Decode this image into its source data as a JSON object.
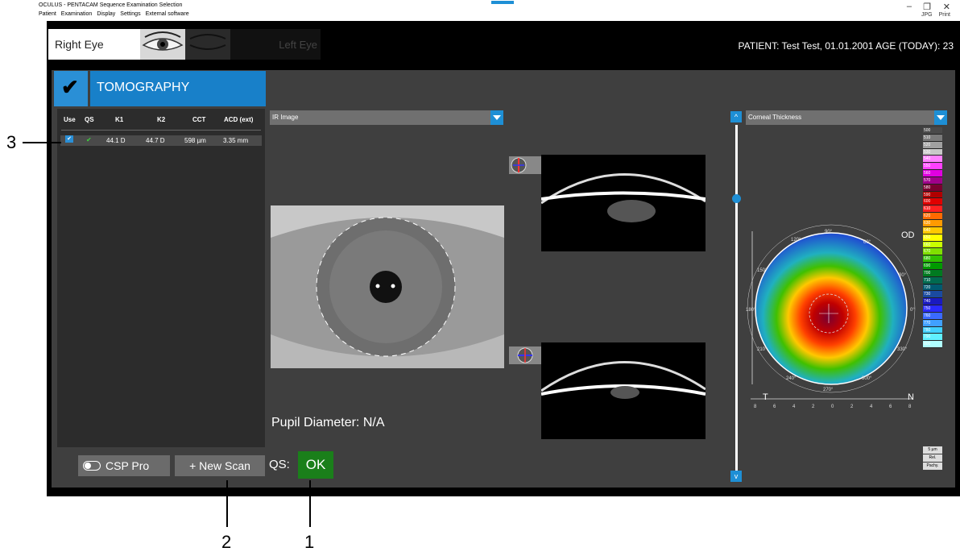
{
  "window": {
    "title": "OCULUS - PENTACAM  Sequence Examination Selection",
    "menu": [
      "Patient",
      "Examination",
      "Display",
      "Settings",
      "External software"
    ],
    "right_links": [
      "JPG",
      "Print"
    ]
  },
  "eye_selector": {
    "right": "Right Eye",
    "left": "Left Eye"
  },
  "patient_info": "PATIENT: Test Test, 01.01.2001   AGE (TODAY): 23",
  "tomography": {
    "check": "✔",
    "label": "TOMOGRAPHY"
  },
  "exam_table": {
    "headers": [
      "Use",
      "QS",
      "K1",
      "K2",
      "CCT",
      "ACD (ext)"
    ],
    "rows": [
      {
        "use": "✔",
        "qs": "✔",
        "k1": "44.1 D",
        "k2": "44.7 D",
        "cct": "598 µm",
        "acd": "3.35 mm"
      }
    ]
  },
  "buttons": {
    "csp_pro": "CSP Pro",
    "new_scan": "+ New Scan"
  },
  "qs": {
    "label": "QS:",
    "status": "OK",
    "status_color": "#1a7f1a"
  },
  "image_panel": {
    "dropdown": "IR Image",
    "pupil": "Pupil Diameter: N/A"
  },
  "map_panel": {
    "dropdown": "Corneal Thickness",
    "od": "OD",
    "t": "T",
    "n": "N",
    "axis_ticks": [
      "8",
      "6",
      "4",
      "2",
      "0",
      "2",
      "4",
      "6",
      "8"
    ],
    "angle_labels": [
      "90°",
      "60°",
      "30°",
      "0°",
      "330°",
      "300°",
      "270°",
      "240°",
      "210°",
      "180°",
      "150°",
      "120°"
    ]
  },
  "slider": {
    "up": "^",
    "down": "v"
  },
  "color_scale": {
    "values": [
      "500",
      "510",
      "520",
      "530",
      "540",
      "550",
      "560",
      "570",
      "580",
      "590",
      "600",
      "610",
      "620",
      "630",
      "640",
      "650",
      "660",
      "670",
      "680",
      "690",
      "700",
      "710",
      "720",
      "730",
      "740",
      "750",
      "760",
      "770",
      "780",
      "790",
      "800"
    ],
    "colors": [
      "#4a4a4a",
      "#7a7a7a",
      "#a0a0a0",
      "#c8c8c8",
      "#ff80ff",
      "#ff40ff",
      "#e000e0",
      "#a0008a",
      "#7a0030",
      "#b00000",
      "#e00000",
      "#ff2020",
      "#ff6a00",
      "#ff9a00",
      "#ffc800",
      "#ffff00",
      "#c8ff00",
      "#80e000",
      "#30c000",
      "#009a00",
      "#007a20",
      "#006a50",
      "#005a70",
      "#1a4aa0",
      "#1a1ac0",
      "#2a2aff",
      "#3a6aff",
      "#40a0ff",
      "#40d0ff",
      "#60f0ff",
      "#b0ffff"
    ],
    "buttons": [
      "5 µm",
      "Rel.",
      "Pachy."
    ]
  },
  "callouts": [
    "3",
    "2",
    "1"
  ]
}
